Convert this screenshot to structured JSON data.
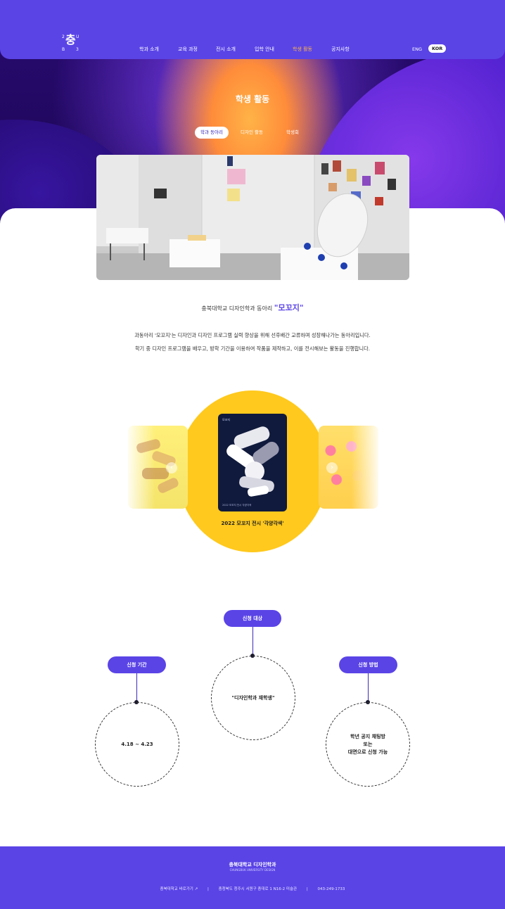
{
  "nav": {
    "logo_text": "충",
    "logo_dots": [
      "2",
      "U",
      "B",
      "3"
    ],
    "items": [
      "학과 소개",
      "교육 과정",
      "전시 소개",
      "입학 안내",
      "학생 활동",
      "공지사항"
    ],
    "active_index": 4,
    "lang_eng": "ENG",
    "lang_kor": "KOR"
  },
  "hero": {
    "title": "학생 활동",
    "tabs": [
      "학과 동아리",
      "디자인 활동",
      "학생회"
    ],
    "active_tab": 0
  },
  "intro": {
    "prefix": "충북대학교 디자인학과 동아리 ",
    "club_name": "\"모꼬지\"",
    "line1": "과동아리 '모꼬지'는 디자인과 디자인 프로그램 실력 향상을 위해 선후배간 교류하며 성장해나가는 동아리입니다.",
    "line2": "학기 중 디자인 프로그램을 배우고, 방학 기간을 이용하여 작품을 제작하고, 이를 전시해보는 활동을 진행합니다."
  },
  "carousel": {
    "caption": "2022 모꼬지 전시 '각양각색'",
    "poster_label": "모꼬지",
    "poster_footer": "2022 모꼬지 전시 각양각색",
    "prev_icon": "chevron-left-icon",
    "next_icon": "chevron-right-icon"
  },
  "apply": {
    "target_label": "신청 대상",
    "target_value": "\"디자인학과 재학생\"",
    "period_label": "신청 기간",
    "period_value": "4.18 ~ 4.23",
    "method_label": "신청 방법",
    "method_line1": "학년 공지 채팅방",
    "method_line2": "또는",
    "method_line3": "대면으로 신청 가능"
  },
  "footer": {
    "title": "충북대학교 디자인학과",
    "subtitle": "CHUNGBUK UNIVERSITY DESIGN",
    "link": "충북대학교 바로가기 ↗",
    "address": "충청북도 청주시 서원구 충대로 1 N16-2 미술관",
    "phone": "043-249-1733"
  },
  "colors": {
    "brand": "#5a44e6",
    "accent": "#ffb347",
    "yellow": "#ffc91d"
  }
}
